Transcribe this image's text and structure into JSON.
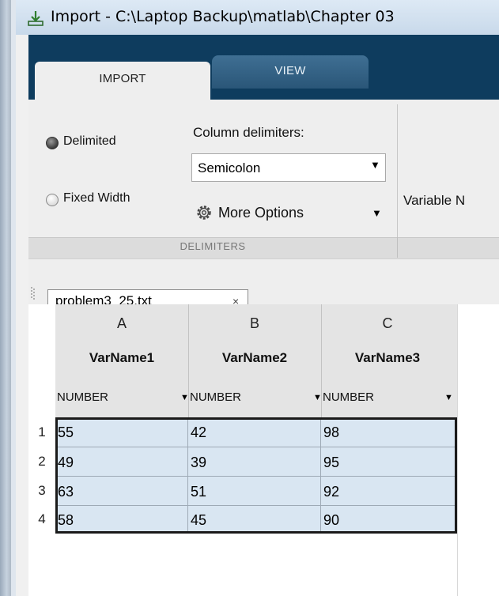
{
  "window": {
    "title": "Import - C:\\Laptop Backup\\matlab\\Chapter 03"
  },
  "tabs": [
    {
      "label": "IMPORT",
      "active": true
    },
    {
      "label": "VIEW",
      "active": false
    }
  ],
  "delimiters": {
    "options": [
      {
        "label": "Delimited",
        "selected": true
      },
      {
        "label": "Fixed Width",
        "selected": false
      }
    ],
    "column_delimiters_label": "Column delimiters:",
    "column_delimiter_value": "Semicolon",
    "more_options_label": "More Options",
    "section_label": "DELIMITERS"
  },
  "variable_names_label": "Variable N",
  "document": {
    "tab_label": "problem3_25.txt",
    "close_glyph": "×"
  },
  "grid": {
    "columns": [
      {
        "letter": "A",
        "varname": "VarName1",
        "type": "NUMBER"
      },
      {
        "letter": "B",
        "varname": "VarName2",
        "type": "NUMBER"
      },
      {
        "letter": "C",
        "varname": "VarName3",
        "type": "NUMBER"
      }
    ],
    "rows": [
      {
        "num": "1",
        "cells": [
          "55",
          "42",
          "98"
        ]
      },
      {
        "num": "2",
        "cells": [
          "49",
          "39",
          "95"
        ]
      },
      {
        "num": "3",
        "cells": [
          "63",
          "51",
          "92"
        ]
      },
      {
        "num": "4",
        "cells": [
          "58",
          "45",
          "90"
        ]
      }
    ]
  },
  "colors": {
    "toolstrip": "#0e3c5e",
    "cell_fill": "#d9e6f2"
  }
}
